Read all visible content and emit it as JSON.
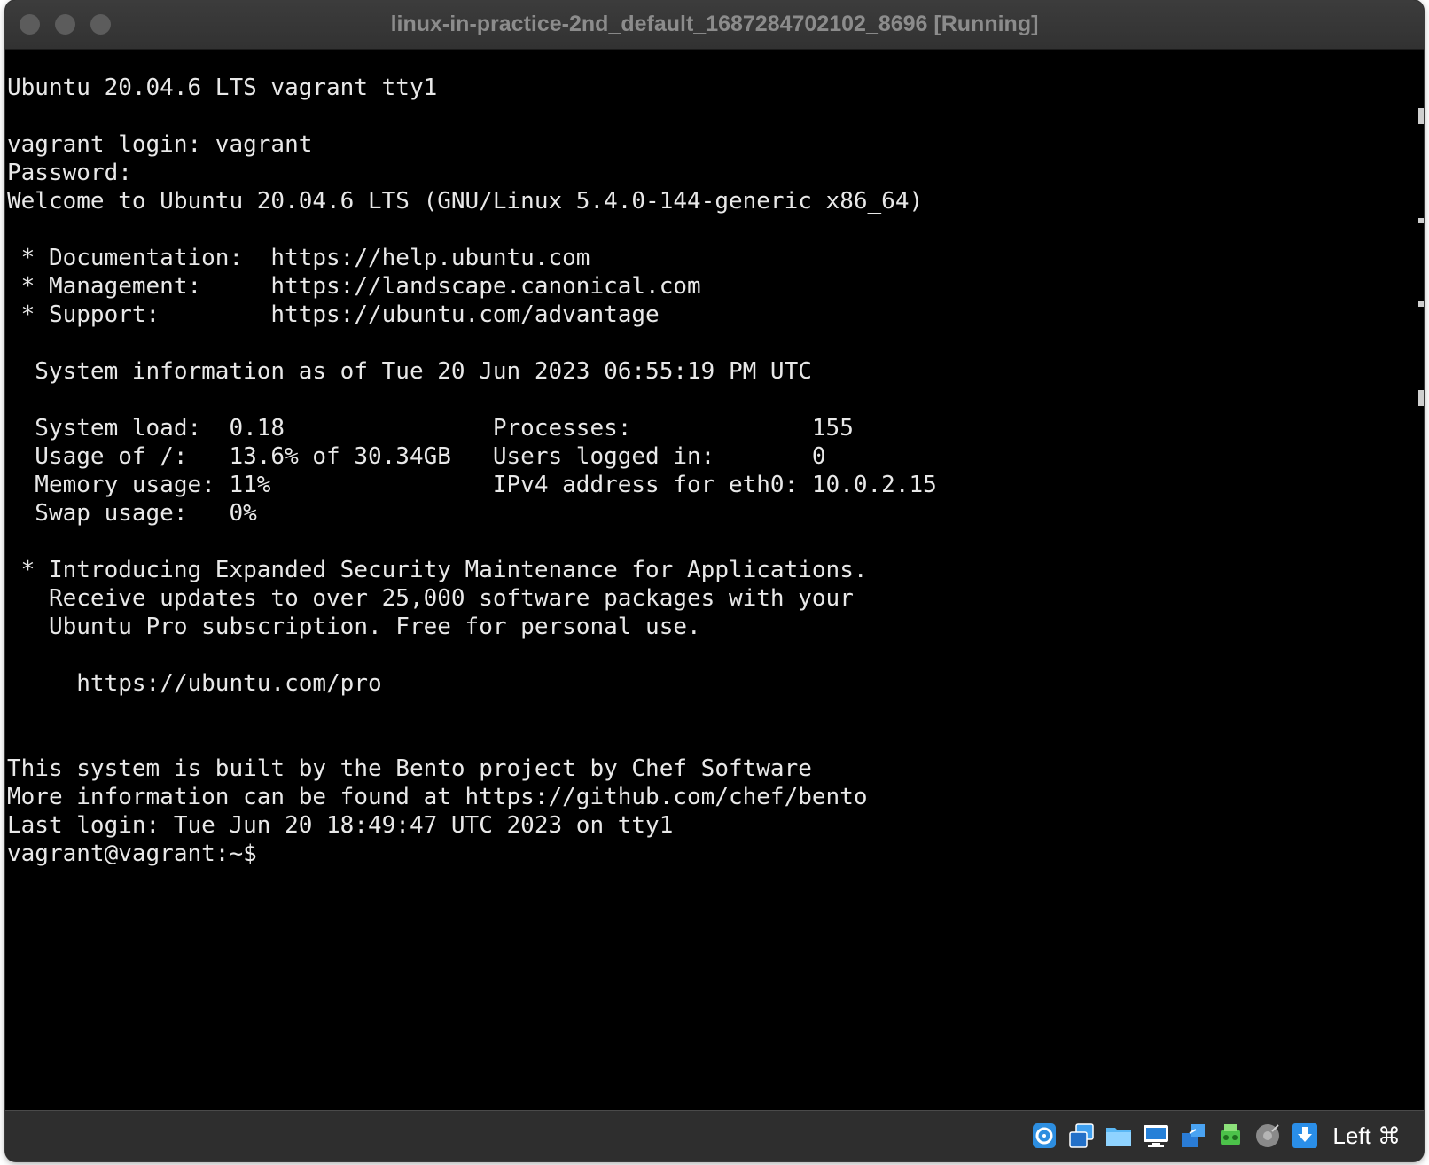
{
  "window": {
    "title": "linux-in-practice-2nd_default_1687284702102_8696 [Running]"
  },
  "terminal": {
    "lines": [
      "Ubuntu 20.04.6 LTS vagrant tty1",
      "",
      "vagrant login: vagrant",
      "Password:",
      "Welcome to Ubuntu 20.04.6 LTS (GNU/Linux 5.4.0-144-generic x86_64)",
      "",
      " * Documentation:  https://help.ubuntu.com",
      " * Management:     https://landscape.canonical.com",
      " * Support:        https://ubuntu.com/advantage",
      "",
      "  System information as of Tue 20 Jun 2023 06:55:19 PM UTC",
      "",
      "  System load:  0.18               Processes:             155",
      "  Usage of /:   13.6% of 30.34GB   Users logged in:       0",
      "  Memory usage: 11%                IPv4 address for eth0: 10.0.2.15",
      "  Swap usage:   0%",
      "",
      " * Introducing Expanded Security Maintenance for Applications.",
      "   Receive updates to over 25,000 software packages with your",
      "   Ubuntu Pro subscription. Free for personal use.",
      "",
      "     https://ubuntu.com/pro",
      "",
      "",
      "This system is built by the Bento project by Chef Software",
      "More information can be found at https://github.com/chef/bento",
      "Last login: Tue Jun 20 18:49:47 UTC 2023 on tty1",
      "vagrant@vagrant:~$"
    ],
    "text_color": "#e8e8e8",
    "background_color": "#000000"
  },
  "statusbar": {
    "icons": [
      "hard-disk-icon",
      "optical-drive-icon",
      "shared-folders-icon",
      "display-icon",
      "network-icon",
      "usb-icon",
      "video-capture-icon",
      "mouse-integration-icon"
    ],
    "host_key_label": "Left ⌘"
  }
}
